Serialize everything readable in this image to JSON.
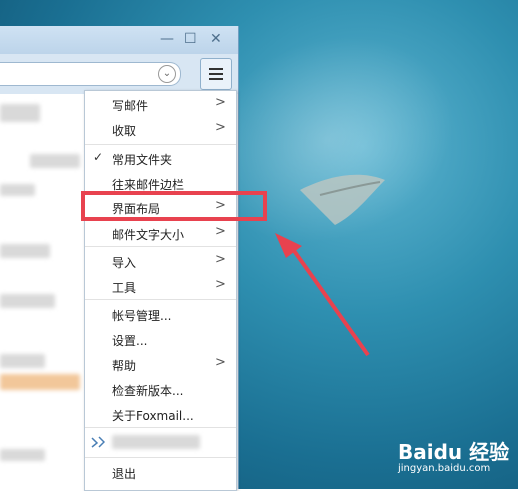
{
  "window_controls": {
    "minimize": "—",
    "maximize": "☐",
    "close": "✕"
  },
  "search": {
    "chevron": "⌄"
  },
  "menu": {
    "items": [
      {
        "label": "写邮件",
        "submenu": true
      },
      {
        "label": "收取",
        "submenu": true
      },
      {
        "label": "常用文件夹",
        "checked": true
      },
      {
        "label": "往来邮件边栏"
      },
      {
        "label": "界面布局",
        "submenu": true
      },
      {
        "label": "邮件文字大小",
        "submenu": true
      },
      {
        "label": "导入",
        "submenu": true
      },
      {
        "label": "工具",
        "submenu": true
      },
      {
        "label": "帐号管理..."
      },
      {
        "label": "设置..."
      },
      {
        "label": "帮助",
        "submenu": true
      },
      {
        "label": "检查新版本..."
      },
      {
        "label": "关于Foxmail..."
      },
      {
        "label": "退出"
      }
    ],
    "arrow_glyph": ">",
    "check_glyph": "✓"
  },
  "watermark": {
    "brand": "Baidu 经验",
    "url": "jingyan.baidu.com"
  },
  "colors": {
    "highlight": "#e8424f",
    "arrow": "#e8424f"
  }
}
